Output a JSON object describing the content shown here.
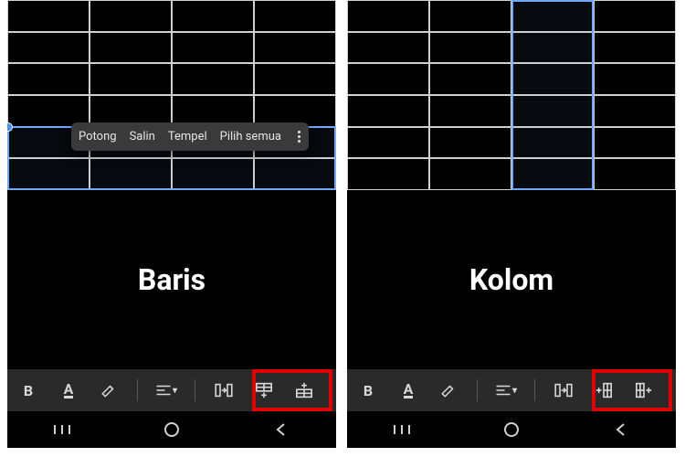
{
  "context_menu": {
    "cut": "Potong",
    "copy": "Salin",
    "paste": "Tempel",
    "select_all": "Pilih semua"
  },
  "left": {
    "label": "Baris"
  },
  "right": {
    "label": "Kolom"
  },
  "toolbar": {
    "bold": "B",
    "text_color": "A"
  },
  "colors": {
    "highlight": "#e20000",
    "selection": "#6fa8ff"
  }
}
